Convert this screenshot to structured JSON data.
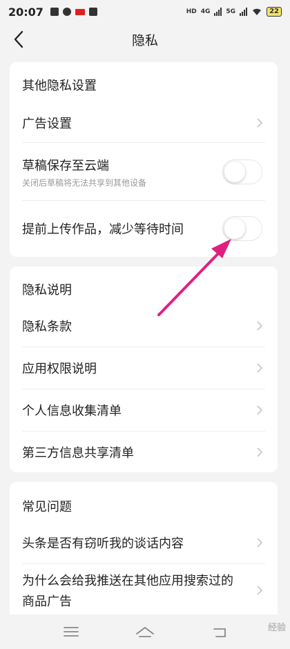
{
  "status_bar": {
    "time": "20:07",
    "network_1": "4G",
    "network_2": "5G",
    "hd": "HD",
    "battery": "22"
  },
  "header": {
    "title": "隐私",
    "back_icon": "chevron-left-icon"
  },
  "sections": {
    "other": {
      "title": "其他隐私设置",
      "ad_settings": "广告设置",
      "draft_cloud": "草稿保存至云端",
      "draft_cloud_sub": "关闭后草稿将无法共享到其他设备",
      "draft_cloud_on": false,
      "pre_upload": "提前上传作品，减少等待时间",
      "pre_upload_on": false
    },
    "privacy": {
      "title": "隐私说明",
      "terms": "隐私条款",
      "permissions": "应用权限说明",
      "personal_info": "个人信息收集清单",
      "third_party": "第三方信息共享清单"
    },
    "faq": {
      "title": "常见问题",
      "q1": "头条是否有窃听我的谈话内容",
      "q2_line1": "为什么会给我推送在其他应用搜索过的",
      "q2_line2": "商品广告"
    }
  },
  "annotation": {
    "arrow_color": "#e0207f"
  },
  "watermark": "经验"
}
